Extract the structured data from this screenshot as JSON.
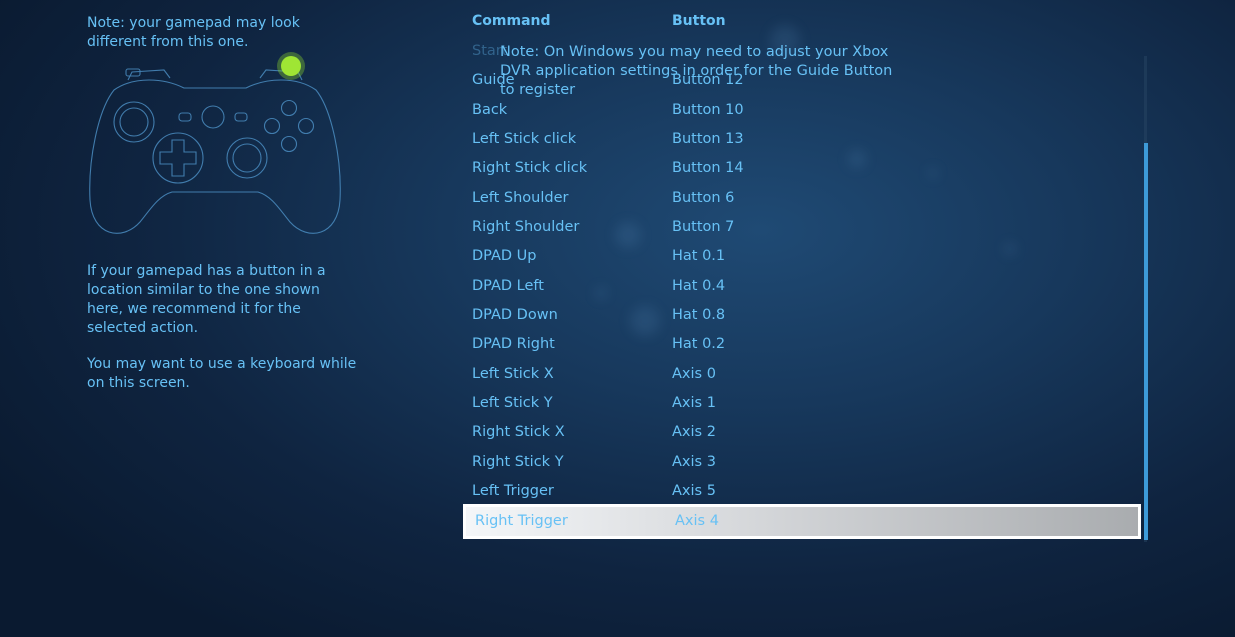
{
  "left_panel": {
    "note": "Note: your gamepad may look\ndifferent from this one.",
    "hint": "If your gamepad has a button in a\nlocation similar to the one shown\nhere, we recommend it for the\nselected action.",
    "keyboard_hint": "You may want to use a keyboard while\non this screen."
  },
  "controller": {
    "icon": "gamepad-icon",
    "highlight_color": "#8fdc2a",
    "outline_color": "#4a8cc0"
  },
  "table": {
    "header_command": "Command",
    "header_button": "Button",
    "rows": [
      {
        "command": "Start",
        "button": ""
      },
      {
        "command": "Guide",
        "button": "Button 12"
      },
      {
        "command": "Back",
        "button": "Button 10"
      },
      {
        "command": "Left Stick click",
        "button": "Button 13"
      },
      {
        "command": "Right Stick click",
        "button": "Button 14"
      },
      {
        "command": "Left Shoulder",
        "button": "Button 6"
      },
      {
        "command": "Right Shoulder",
        "button": "Button 7"
      },
      {
        "command": "DPAD Up",
        "button": "Hat 0.1"
      },
      {
        "command": "DPAD Left",
        "button": "Hat 0.4"
      },
      {
        "command": "DPAD Down",
        "button": "Hat 0.8"
      },
      {
        "command": "DPAD Right",
        "button": "Hat 0.2"
      },
      {
        "command": "Left Stick X",
        "button": "Axis 0"
      },
      {
        "command": "Left Stick Y",
        "button": "Axis 1"
      },
      {
        "command": "Right Stick X",
        "button": "Axis 2"
      },
      {
        "command": "Right Stick Y",
        "button": "Axis 3"
      },
      {
        "command": "Left Trigger",
        "button": "Axis 5"
      },
      {
        "command": "Right Trigger",
        "button": "Axis 4"
      }
    ],
    "selected_command": "Right Trigger"
  },
  "tooltip": {
    "text": "Note: On Windows you may need to adjust your Xbox\nDVR application settings in order for the Guide Button\nto register"
  },
  "colors": {
    "text": "#67c1f5",
    "scrollbar": "#3d9ad8",
    "selection_border": "#ffffff"
  }
}
